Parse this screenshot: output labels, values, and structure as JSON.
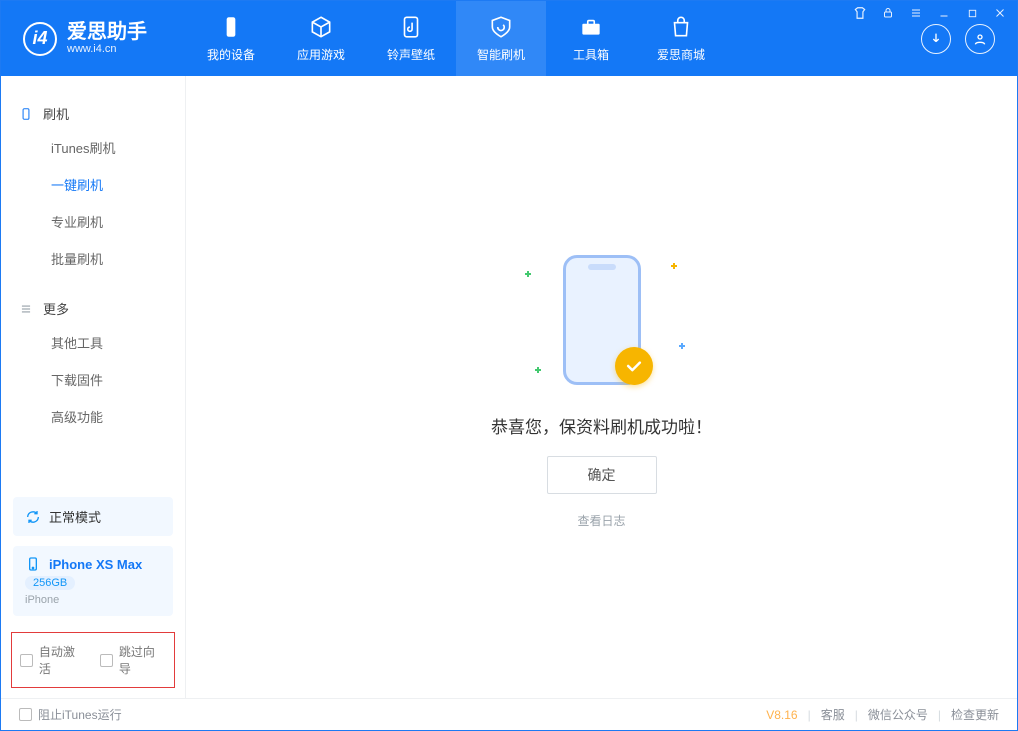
{
  "app": {
    "title": "爱思助手",
    "subtitle": "www.i4.cn"
  },
  "nav": {
    "items": [
      {
        "id": "device",
        "label": "我的设备"
      },
      {
        "id": "apps",
        "label": "应用游戏"
      },
      {
        "id": "ring",
        "label": "铃声壁纸"
      },
      {
        "id": "flash",
        "label": "智能刷机"
      },
      {
        "id": "toolbox",
        "label": "工具箱"
      },
      {
        "id": "store",
        "label": "爱思商城"
      }
    ],
    "active": "flash"
  },
  "sidebar": {
    "groups": [
      {
        "title": "刷机",
        "items": [
          {
            "id": "itunes",
            "label": "iTunes刷机"
          },
          {
            "id": "oneclick",
            "label": "一键刷机"
          },
          {
            "id": "pro",
            "label": "专业刷机"
          },
          {
            "id": "batch",
            "label": "批量刷机"
          }
        ],
        "active": "oneclick"
      },
      {
        "title": "更多",
        "items": [
          {
            "id": "other",
            "label": "其他工具"
          },
          {
            "id": "fw",
            "label": "下载固件"
          },
          {
            "id": "adv",
            "label": "高级功能"
          }
        ]
      }
    ],
    "mode_panel": {
      "label": "正常模式"
    },
    "device_panel": {
      "name": "iPhone XS Max",
      "storage": "256GB",
      "type": "iPhone"
    },
    "options": {
      "auto_activate": "自动激活",
      "skip_guide": "跳过向导"
    }
  },
  "main": {
    "success_text": "恭喜您，保资料刷机成功啦！",
    "ok_button": "确定",
    "view_log": "查看日志"
  },
  "footer": {
    "block_itunes": "阻止iTunes运行",
    "version": "V8.16",
    "links": {
      "support": "客服",
      "wechat": "微信公众号",
      "update": "检查更新"
    }
  }
}
